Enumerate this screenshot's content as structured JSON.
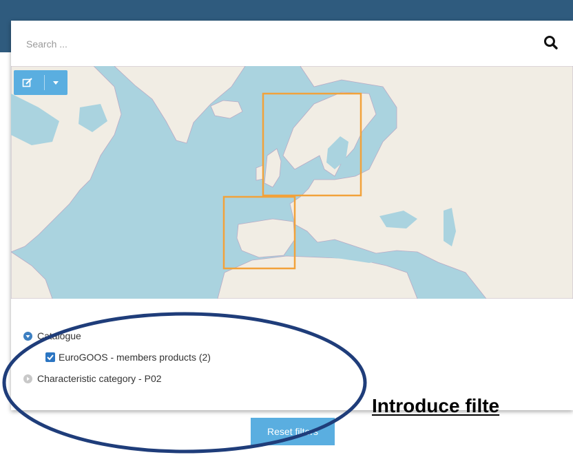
{
  "search": {
    "placeholder": "Search ..."
  },
  "map_tools": {
    "draw_icon": "pencil-square-icon",
    "dropdown_icon": "caret-down-icon"
  },
  "facets": {
    "catalogue": {
      "label": "Catalogue",
      "icon": "circle-arrow-down-icon"
    },
    "catalogue_items": [
      {
        "label": "EuroGOOS - members products (2)",
        "checked": true
      }
    ],
    "characteristic": {
      "label": "Characteristic category - P02",
      "icon": "circle-arrow-right-icon"
    }
  },
  "reset_label": "Reset filters",
  "annotation": {
    "text": "Introduce filte"
  },
  "colors": {
    "header": "#2f5b7e",
    "sea": "#aad3df",
    "land": "#f1ede4",
    "bbox": "#f2a23a",
    "button": "#5aaee0",
    "ellipse": "#1f3d7a"
  }
}
